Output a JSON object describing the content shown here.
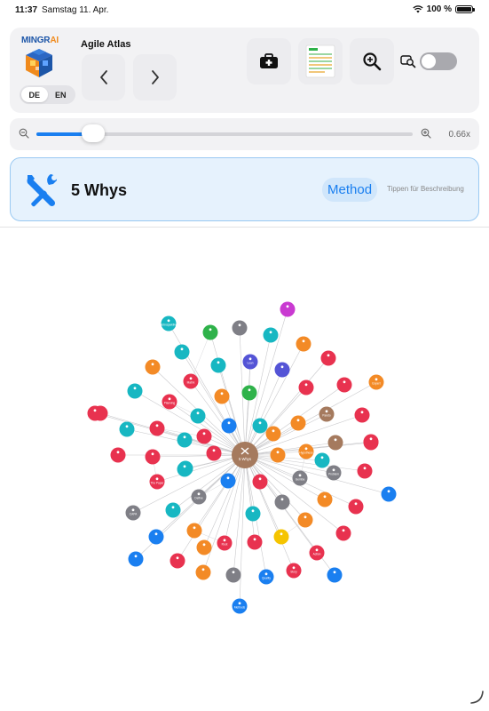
{
  "status": {
    "time": "11:37",
    "date": "Samstag 11. Apr.",
    "battery": "100 %"
  },
  "header": {
    "logo_text_a": "MINGR",
    "logo_text_b": "AI",
    "app_title": "Agile Atlas",
    "lang": {
      "de": "DE",
      "en": "EN",
      "active": "DE"
    }
  },
  "zoom": {
    "value_label": "0.66x",
    "level": 0.12
  },
  "method": {
    "title": "5 Whys",
    "badge": "Method",
    "hint": "Tippen für Beschreibung"
  },
  "graph": {
    "center": {
      "label": "5 Whys",
      "color": "#a57a5e"
    },
    "nodes": [
      {
        "color": "#17b7c2",
        "label": "Retrospektive"
      },
      {
        "color": "#7f7f86",
        "label": ""
      },
      {
        "color": "#c93ad1",
        "label": ""
      },
      {
        "color": "#2fb24a",
        "label": ""
      },
      {
        "color": "#17b7c2",
        "label": ""
      },
      {
        "color": "#f38a26",
        "label": ""
      },
      {
        "color": "#17b7c2",
        "label": ""
      },
      {
        "color": "#e8324f",
        "label": ""
      },
      {
        "color": "#5454d6",
        "label": "Lean"
      },
      {
        "color": "#5454d6",
        "label": ""
      },
      {
        "color": "#f38a26",
        "label": ""
      },
      {
        "color": "#17b7c2",
        "label": ""
      },
      {
        "color": "#e8324f",
        "label": "Matrix"
      },
      {
        "color": "#e8324f",
        "label": ""
      },
      {
        "color": "#f38a26",
        "label": "Expert"
      },
      {
        "color": "#17b7c2",
        "label": ""
      },
      {
        "color": "#e8324f",
        "label": ""
      },
      {
        "color": "#2fb24a",
        "label": ""
      },
      {
        "color": "#f38a26",
        "label": ""
      },
      {
        "color": "#e8324f",
        "label": "Planning"
      },
      {
        "color": "#e8324f",
        "label": ""
      },
      {
        "color": "#e8324f",
        "label": ""
      },
      {
        "color": "#17b7c2",
        "label": ""
      },
      {
        "color": "#1a7ff0",
        "label": ""
      },
      {
        "color": "#a57a5e",
        "label": "Pareto"
      },
      {
        "color": "#e8324f",
        "label": ""
      },
      {
        "color": "#f38a26",
        "label": ""
      },
      {
        "color": "#17b7c2",
        "label": ""
      },
      {
        "color": "#e8324f",
        "label": ""
      },
      {
        "color": "#17b7c2",
        "label": ""
      },
      {
        "color": "#f38a26",
        "label": ""
      },
      {
        "color": "#17b7c2",
        "label": ""
      },
      {
        "color": "#a57a5e",
        "label": ""
      },
      {
        "color": "#e8324f",
        "label": ""
      },
      {
        "color": "#e8324f",
        "label": ""
      },
      {
        "color": "#e8324f",
        "label": "The Paper"
      },
      {
        "color": "#17b7c2",
        "label": ""
      },
      {
        "color": "#e8324f",
        "label": ""
      },
      {
        "color": "#f38a26",
        "label": ""
      },
      {
        "color": "#f38a26",
        "label": "Hypothese"
      },
      {
        "color": "#7f7f86",
        "label": "Problem"
      },
      {
        "color": "#e8324f",
        "label": ""
      },
      {
        "color": "#17b7c2",
        "label": ""
      },
      {
        "color": "#e8324f",
        "label": ""
      },
      {
        "color": "#7f7f86",
        "label": "Gemba"
      },
      {
        "color": "#17b7c2",
        "label": ""
      },
      {
        "color": "#e8324f",
        "label": ""
      },
      {
        "color": "#7f7f86",
        "label": "Define"
      },
      {
        "color": "#f38a26",
        "label": ""
      },
      {
        "color": "#1a7ff0",
        "label": ""
      },
      {
        "color": "#7f7f86",
        "label": "CAPA"
      },
      {
        "color": "#17b7c2",
        "label": ""
      },
      {
        "color": "#17b7c2",
        "label": ""
      },
      {
        "color": "#7f7f86",
        "label": ""
      },
      {
        "color": "#e8324f",
        "label": ""
      },
      {
        "color": "#f38a26",
        "label": ""
      },
      {
        "color": "#f38a26",
        "label": ""
      },
      {
        "color": "#1a7ff0",
        "label": ""
      },
      {
        "color": "#e8324f",
        "label": "Root"
      },
      {
        "color": "#e8324f",
        "label": ""
      },
      {
        "color": "#f5c400",
        "label": ""
      },
      {
        "color": "#f38a26",
        "label": ""
      },
      {
        "color": "#e8324f",
        "label": ""
      },
      {
        "color": "#1a7ff0",
        "label": ""
      },
      {
        "color": "#e8324f",
        "label": "Action"
      },
      {
        "color": "#e8324f",
        "label": ""
      },
      {
        "color": "#f38a26",
        "label": ""
      },
      {
        "color": "#7f7f86",
        "label": ""
      },
      {
        "color": "#1a7ff0",
        "label": "Quality"
      },
      {
        "color": "#e8324f",
        "label": "Story"
      },
      {
        "color": "#1a7ff0",
        "label": ""
      },
      {
        "color": "#1a7ff0",
        "label": ""
      },
      {
        "color": "#1a7ff0",
        "label": "Methods"
      },
      {
        "color": "#e8324f",
        "label": ""
      },
      {
        "color": "#e8324f",
        "label": ""
      }
    ]
  }
}
